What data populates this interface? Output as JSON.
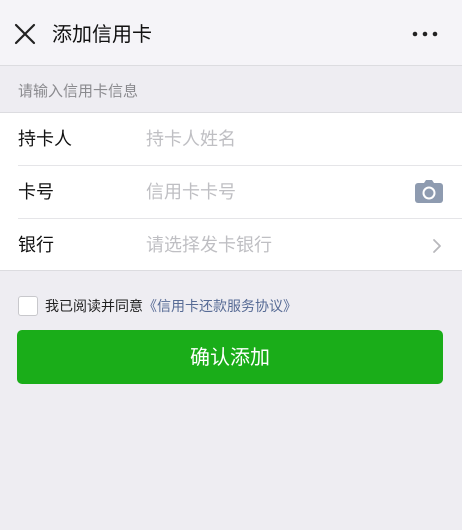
{
  "header": {
    "title": "添加信用卡",
    "close_icon": "close-icon",
    "more_icon": "more-icon"
  },
  "form": {
    "section_label": "请输入信用卡信息",
    "rows": [
      {
        "label": "持卡人",
        "placeholder": "持卡人姓名",
        "value": ""
      },
      {
        "label": "卡号",
        "placeholder": "信用卡卡号",
        "value": "",
        "icon": "camera-icon"
      },
      {
        "label": "银行",
        "value": "请选择发卡银行",
        "icon": "chevron-right-icon"
      }
    ]
  },
  "agreement": {
    "checked": false,
    "text": "我已阅读并同意",
    "link_text": "《信用卡还款服务协议》"
  },
  "confirm_button": {
    "label": "确认添加"
  },
  "colors": {
    "background": "#eeedf2",
    "primary_button": "#1aad19",
    "link": "#576b95",
    "placeholder": "#bfbfc3",
    "icon_gray": "#8e9bb0"
  }
}
